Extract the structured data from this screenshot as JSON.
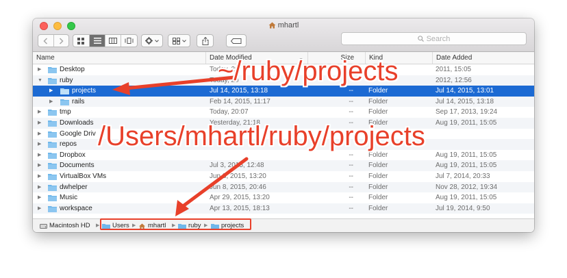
{
  "window": {
    "title": "mhartl"
  },
  "search": {
    "placeholder": "Search"
  },
  "columns": {
    "name": "Name",
    "date_modified": "Date Modified",
    "size": "Size",
    "kind": "Kind",
    "date_added": "Date Added"
  },
  "rows": [
    {
      "name": "Desktop",
      "modified": "Today, 20:",
      "size": "",
      "kind": "",
      "added": "2011, 15:05",
      "expanded": false
    },
    {
      "name": "ruby",
      "modified": "Today, 20",
      "size": "",
      "kind": "",
      "added": "2012, 12:56",
      "expanded": true
    },
    {
      "name": "projects",
      "modified": "Jul 14, 2015, 13:18",
      "size": "--",
      "kind": "Folder",
      "added": "Jul 14, 2015, 13:01",
      "selected": true
    },
    {
      "name": "rails",
      "modified": "Feb 14, 2015, 11:17",
      "size": "--",
      "kind": "Folder",
      "added": "Jul 14, 2015, 13:18"
    },
    {
      "name": "tmp",
      "modified": "Today, 20:07",
      "size": "--",
      "kind": "Folder",
      "added": "Sep 17, 2013, 19:24"
    },
    {
      "name": "Downloads",
      "modified": "Yesterday, 21:18",
      "size": "--",
      "kind": "Folder",
      "added": "Aug 19, 2011, 15:05"
    },
    {
      "name": "Google Driv",
      "modified": "",
      "size": "",
      "kind": "",
      "added": ""
    },
    {
      "name": "repos",
      "modified": "",
      "size": "",
      "kind": "",
      "added": ""
    },
    {
      "name": "Dropbox",
      "modified": "",
      "size": "--",
      "kind": "Folder",
      "added": "Aug 19, 2011, 15:05"
    },
    {
      "name": "Documents",
      "modified": "Jul 3, 2015, 12:48",
      "size": "--",
      "kind": "Folder",
      "added": "Aug 19, 2011, 15:05"
    },
    {
      "name": "VirtualBox VMs",
      "modified": "Jun 8, 2015, 13:20",
      "size": "--",
      "kind": "Folder",
      "added": "Jul 7, 2014, 20:33"
    },
    {
      "name": "dwhelper",
      "modified": "Jun 8, 2015, 20:46",
      "size": "--",
      "kind": "Folder",
      "added": "Nov 28, 2012, 19:34"
    },
    {
      "name": "Music",
      "modified": "Apr 29, 2015, 13:20",
      "size": "--",
      "kind": "Folder",
      "added": "Aug 19, 2011, 15:05"
    },
    {
      "name": "workspace",
      "modified": "Apr 13, 2015, 18:13",
      "size": "--",
      "kind": "Folder",
      "added": "Jul 19, 2014, 9:50"
    }
  ],
  "pathbar": {
    "items": [
      "Macintosh HD",
      "Users",
      "mhartl",
      "ruby",
      "projects"
    ]
  },
  "annotations": {
    "tilde_path": "~/ruby/projects",
    "full_path": "/Users/mhartl/ruby/projects"
  },
  "colors": {
    "accent": "#e8402a",
    "selection": "#1c6ad3",
    "folder": "#6fb7ea"
  }
}
